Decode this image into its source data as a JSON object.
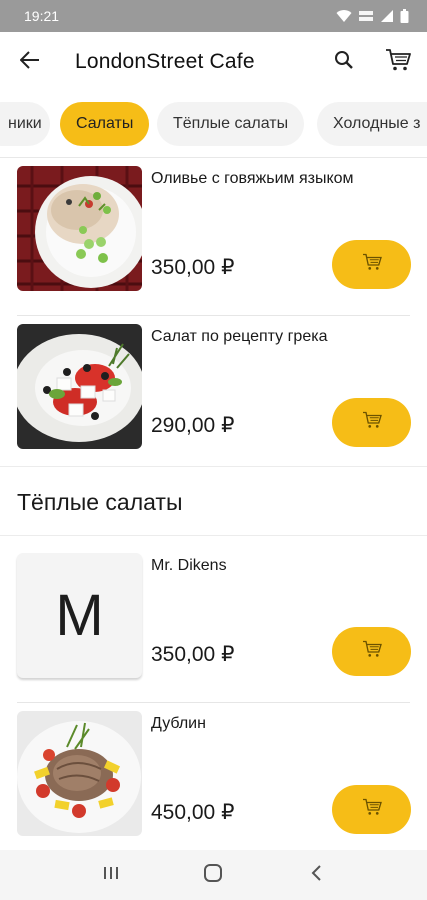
{
  "status_bar": {
    "time": "19:21",
    "icons": [
      "wifi-icon",
      "volte-lte-icon",
      "signal-icon",
      "battery-icon"
    ]
  },
  "app_bar": {
    "title": "LondonStreet Cafe",
    "back_icon": "arrow-left-icon",
    "search_icon": "search-icon",
    "cart_icon": "cart-icon"
  },
  "category_tabs": [
    {
      "label": "ники",
      "active": false
    },
    {
      "label": "Салаты",
      "active": true
    },
    {
      "label": "Тёплые салаты",
      "active": false
    },
    {
      "label": "Холодные з",
      "active": false
    }
  ],
  "sections": {
    "warm_salads_title": "Тёплые салаты"
  },
  "products": [
    {
      "name": "Оливье с говяжьим языком",
      "price": "350,00 ₽",
      "image": "olivier-salad-photo"
    },
    {
      "name": "Салат по рецепту грека",
      "price": "290,00 ₽",
      "image": "greek-salad-photo"
    },
    {
      "name": "Mr. Dikens",
      "price": "350,00 ₽",
      "placeholder_letter": "M"
    },
    {
      "name": "Дублин",
      "price": "450,00 ₽",
      "image": "dublin-salad-photo"
    }
  ],
  "colors": {
    "accent": "#f6bd17",
    "status_bar": "#9a9a9a",
    "tab_inactive": "#f3f3f3",
    "nav_bar": "#f5f5f5"
  },
  "nav_bar": {
    "icons": [
      "recent-apps-icon",
      "home-icon",
      "back-icon"
    ]
  }
}
